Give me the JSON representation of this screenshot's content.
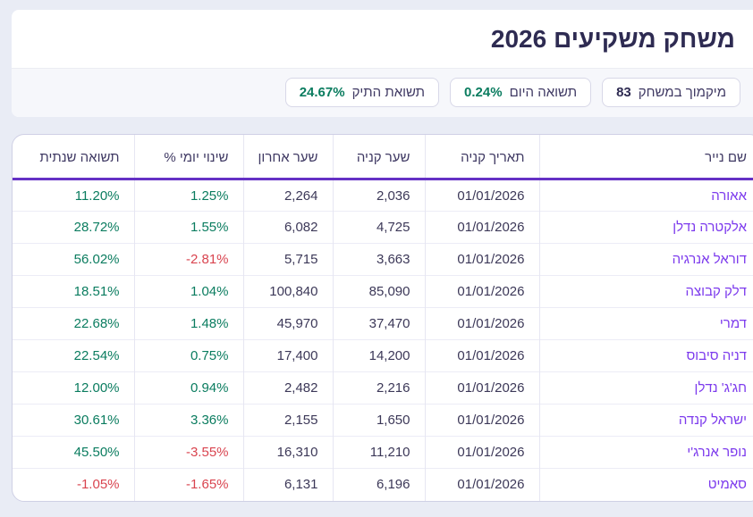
{
  "colors": {
    "page_bg": "#e9ecf5",
    "card_bg": "#ffffff",
    "band_bg": "#f6f7fb",
    "title_text": "#2e2b52",
    "header_text": "#3f3963",
    "cell_text": "#3c3858",
    "accent_purple": "#6531c5",
    "link_purple": "#7c3aed",
    "positive_green": "#0a7c5f",
    "negative_red": "#d9444f",
    "card_border": "#cfd0e5",
    "badge_border": "#d8d8e8",
    "row_border": "#ececf6",
    "col_border": "#e6e6f2"
  },
  "header": {
    "title": "משחק משקיעים 2026"
  },
  "badges": [
    {
      "label": "מיקמוך במשחק",
      "value": "83",
      "tone": "neutral"
    },
    {
      "label": "תשואה היום",
      "value": "0.24%",
      "tone": "positive"
    },
    {
      "label": "תשואת התיק",
      "value": "24.67%",
      "tone": "positive"
    }
  ],
  "table": {
    "columns": [
      "שם נייר",
      "תאריך קניה",
      "שער קניה",
      "שער אחרון",
      "שינוי יומי %",
      "תשואה שנתית"
    ],
    "rows": [
      {
        "name": "אאורה",
        "buy_date": "01/01/2026",
        "buy_price": "2,036",
        "last_price": "2,264",
        "daily_change_pct": "1.25%",
        "annual_return_pct": "11.20%"
      },
      {
        "name": "אלקטרה נדלן",
        "buy_date": "01/01/2026",
        "buy_price": "4,725",
        "last_price": "6,082",
        "daily_change_pct": "1.55%",
        "annual_return_pct": "28.72%"
      },
      {
        "name": "דוראל אנרגיה",
        "buy_date": "01/01/2026",
        "buy_price": "3,663",
        "last_price": "5,715",
        "daily_change_pct": "-2.81%",
        "annual_return_pct": "56.02%"
      },
      {
        "name": "דלק קבוצה",
        "buy_date": "01/01/2026",
        "buy_price": "85,090",
        "last_price": "100,840",
        "daily_change_pct": "1.04%",
        "annual_return_pct": "18.51%"
      },
      {
        "name": "דמרי",
        "buy_date": "01/01/2026",
        "buy_price": "37,470",
        "last_price": "45,970",
        "daily_change_pct": "1.48%",
        "annual_return_pct": "22.68%"
      },
      {
        "name": "דניה סיבוס",
        "buy_date": "01/01/2026",
        "buy_price": "14,200",
        "last_price": "17,400",
        "daily_change_pct": "0.75%",
        "annual_return_pct": "22.54%"
      },
      {
        "name": "חג'ג' נדלן",
        "buy_date": "01/01/2026",
        "buy_price": "2,216",
        "last_price": "2,482",
        "daily_change_pct": "0.94%",
        "annual_return_pct": "12.00%"
      },
      {
        "name": "ישראל קנדה",
        "buy_date": "01/01/2026",
        "buy_price": "1,650",
        "last_price": "2,155",
        "daily_change_pct": "3.36%",
        "annual_return_pct": "30.61%"
      },
      {
        "name": "נופר אנרג'י",
        "buy_date": "01/01/2026",
        "buy_price": "11,210",
        "last_price": "16,310",
        "daily_change_pct": "-3.55%",
        "annual_return_pct": "45.50%"
      },
      {
        "name": "סאמיט",
        "buy_date": "01/01/2026",
        "buy_price": "6,196",
        "last_price": "6,131",
        "daily_change_pct": "-1.65%",
        "annual_return_pct": "-1.05%"
      }
    ]
  }
}
